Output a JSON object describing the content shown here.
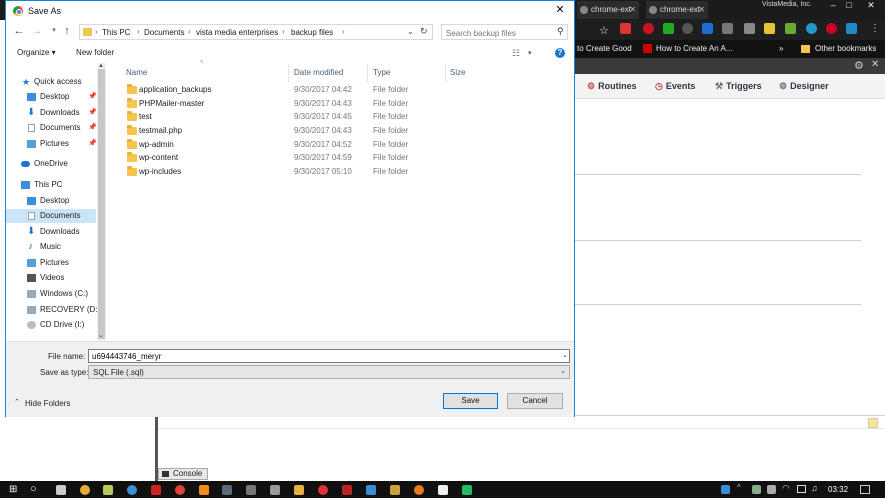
{
  "colors": {
    "accent": "#0078d7",
    "folder": "#f5c64d",
    "selection": "#cce4f7",
    "taskbar": "#101010"
  },
  "browser": {
    "tabs": [
      "chrome-ext",
      "chrome-ext"
    ],
    "profile": "VistaMedia, Inc.",
    "bookmarks": [
      "to Create Good",
      "How to Create An A...",
      "»",
      "Other bookmarks"
    ],
    "menu": [
      "Routines",
      "Events",
      "Triggers",
      "Designer"
    ],
    "console_label": "Console"
  },
  "dialog": {
    "title": "Save As",
    "close_glyph": "✕",
    "breadcrumb": [
      "This PC",
      "Documents",
      "vista media enterprises",
      "backup files"
    ],
    "search_placeholder": "Search backup files",
    "organize_label": "Organize ▾",
    "new_folder_label": "New folder",
    "help_glyph": "?",
    "nav": [
      {
        "label": "Quick access",
        "icon": "star-icon",
        "pinned": false
      },
      {
        "label": "Desktop",
        "icon": "desktop-icon",
        "pinned": true
      },
      {
        "label": "Downloads",
        "icon": "download-icon",
        "pinned": true
      },
      {
        "label": "Documents",
        "icon": "documents-icon",
        "pinned": true
      },
      {
        "label": "Pictures",
        "icon": "pictures-icon",
        "pinned": true
      },
      {
        "label": "OneDrive",
        "icon": "cloud-icon",
        "pinned": false
      },
      {
        "label": "This PC",
        "icon": "computer-icon",
        "pinned": false
      },
      {
        "label": "Desktop",
        "icon": "desktop-icon",
        "pinned": false
      },
      {
        "label": "Documents",
        "icon": "documents-icon",
        "pinned": false
      },
      {
        "label": "Downloads",
        "icon": "download-icon",
        "pinned": false
      },
      {
        "label": "Music",
        "icon": "music-icon",
        "pinned": false
      },
      {
        "label": "Pictures",
        "icon": "pictures-icon",
        "pinned": false
      },
      {
        "label": "Videos",
        "icon": "videos-icon",
        "pinned": false
      },
      {
        "label": "Windows (C:)",
        "icon": "drive-icon",
        "pinned": false
      },
      {
        "label": "RECOVERY (D:)",
        "icon": "drive-icon",
        "pinned": false
      },
      {
        "label": "CD Drive (I:)",
        "icon": "cd-drive-icon",
        "pinned": false
      }
    ],
    "columns": [
      "Name",
      "Date modified",
      "Type",
      "Size"
    ],
    "files": [
      {
        "name": "application_backups",
        "date": "9/30/2017 04:42",
        "type": "File folder"
      },
      {
        "name": "PHPMailer-master",
        "date": "9/30/2017 04:43",
        "type": "File folder"
      },
      {
        "name": "test",
        "date": "9/30/2017 04:45",
        "type": "File folder"
      },
      {
        "name": "testmail.php",
        "date": "9/30/2017 04:43",
        "type": "File folder"
      },
      {
        "name": "wp-admin",
        "date": "9/30/2017 04:52",
        "type": "File folder"
      },
      {
        "name": "wp-content",
        "date": "9/30/2017 04:59",
        "type": "File folder"
      },
      {
        "name": "wp-includes",
        "date": "9/30/2017 05:10",
        "type": "File folder"
      }
    ],
    "file_name_label": "File name:",
    "file_name_value": "u694443746_meryr",
    "save_type_label": "Save as type:",
    "save_type_value": "SQL File (.sql)",
    "hide_folders_label": "Hide Folders",
    "save_label": "Save",
    "cancel_label": "Cancel"
  },
  "taskbar": {
    "clock": "03:32"
  }
}
